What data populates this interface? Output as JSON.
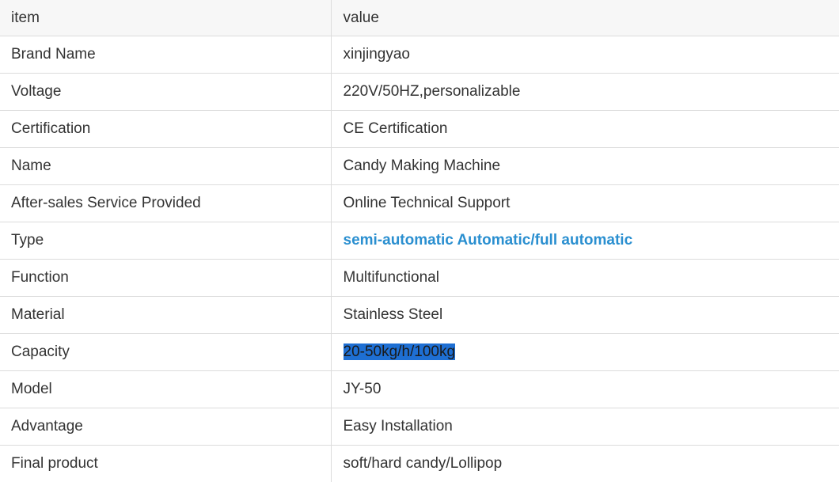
{
  "header": {
    "item_label": "item",
    "value_label": "value"
  },
  "rows": [
    {
      "item": "Brand Name",
      "value": "xinjingyao"
    },
    {
      "item": "Voltage",
      "value": "220V/50HZ,personalizable"
    },
    {
      "item": "Certification",
      "value": "CE Certification"
    },
    {
      "item": "Name",
      "value": "Candy Making Machine"
    },
    {
      "item": "After-sales Service Provided",
      "value": "Online Technical Support"
    },
    {
      "item": "Type",
      "value": "semi-automatic Automatic/full automatic"
    },
    {
      "item": "Function",
      "value": "Multifunctional"
    },
    {
      "item": "Material",
      "value": "Stainless Steel"
    },
    {
      "item": "Capacity",
      "value": "20-50kg/h/100kg"
    },
    {
      "item": "Model",
      "value": "JY-50"
    },
    {
      "item": "Advantage",
      "value": "Easy Installation"
    },
    {
      "item": "Final product",
      "value": "soft/hard candy/Lollipop"
    }
  ],
  "colors": {
    "link": "#2a8fd0",
    "selection": "#1e6fd3",
    "header_bg": "#f7f7f7",
    "border": "#dcdcdc"
  }
}
